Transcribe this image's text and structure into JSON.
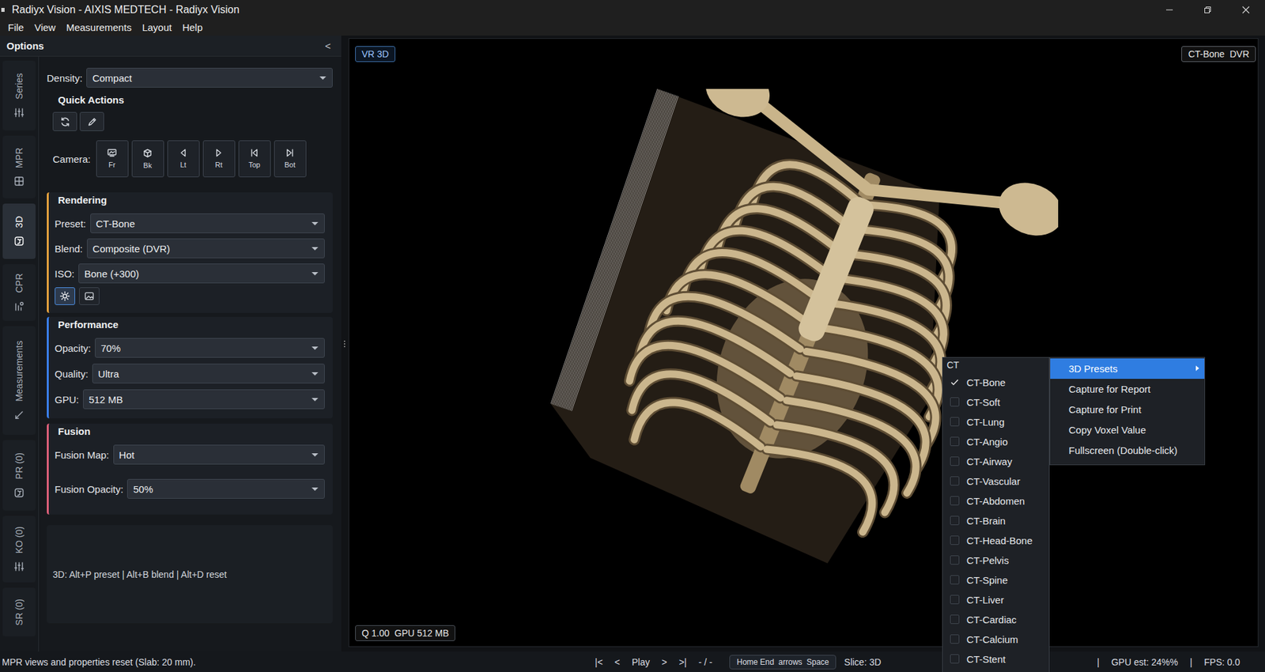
{
  "window": {
    "title": "Radiyx Vision - AIXIS MEDTECH - Radiyx Vision"
  },
  "menu_bar": [
    {
      "label": "File"
    },
    {
      "label": "View"
    },
    {
      "label": "Measurements"
    },
    {
      "label": "Layout"
    },
    {
      "label": "Help"
    }
  ],
  "options_panel": {
    "title": "Options",
    "collapse": "<"
  },
  "side_tabs": [
    {
      "label": "Series",
      "selected": false
    },
    {
      "label": "MPR",
      "selected": false
    },
    {
      "label": "3D",
      "selected": true
    },
    {
      "label": "CPR",
      "selected": false
    },
    {
      "label": "Measurements",
      "selected": false
    },
    {
      "label": "PR (0)",
      "selected": false
    },
    {
      "label": "KO (0)",
      "selected": false
    },
    {
      "label": "SR (0)",
      "selected": false
    }
  ],
  "density": {
    "label": "Density:",
    "value": "Compact"
  },
  "quick_actions": {
    "title": "Quick Actions"
  },
  "camera": {
    "label": "Camera:",
    "buttons": [
      "Fr",
      "Bk",
      "Lt",
      "Rt",
      "Top",
      "Bot"
    ]
  },
  "sections": [
    {
      "title": "Rendering",
      "color": "#e8a33d",
      "fields": [
        {
          "label": "Preset:",
          "value": "CT-Bone"
        },
        {
          "label": "Blend:",
          "value": "Composite (DVR)"
        },
        {
          "label": "ISO:",
          "value": "Bone (+300)"
        }
      ],
      "toggles": [
        {
          "selected": true
        },
        {
          "selected": false
        }
      ]
    },
    {
      "title": "Performance",
      "color": "#3b82f6",
      "fields": [
        {
          "label": "Opacity:",
          "value": "70%"
        },
        {
          "label": "Quality:",
          "value": "Ultra"
        },
        {
          "label": "GPU:",
          "value": "512 MB"
        }
      ],
      "toggles": []
    },
    {
      "title": "Fusion",
      "color": "#e0607a",
      "fields": [
        {
          "label": "Fusion Map:",
          "value": "Hot"
        },
        {
          "label": "Fusion Opacity:",
          "value": "50%"
        }
      ],
      "toggles": []
    }
  ],
  "hint": "3D: Alt+P preset | Alt+B blend | Alt+D reset",
  "viewport": {
    "mode": "VR 3D",
    "preset": "CT-Bone  DVR",
    "info": "Q 1.00  GPU 512 MB"
  },
  "context_menu": [
    {
      "label": "3D Presets",
      "selected": true,
      "submenu": true
    },
    {
      "label": "Capture for Report",
      "selected": false,
      "submenu": false
    },
    {
      "label": "Capture for Print",
      "selected": false,
      "submenu": false
    },
    {
      "label": "Copy Voxel Value",
      "selected": false,
      "submenu": false
    },
    {
      "label": "Fullscreen (Double-click)",
      "selected": false,
      "submenu": false
    }
  ],
  "presets_menu": {
    "header": "CT",
    "items": [
      {
        "label": "CT-Bone",
        "checked": true
      },
      {
        "label": "CT-Soft",
        "checked": false
      },
      {
        "label": "CT-Lung",
        "checked": false
      },
      {
        "label": "CT-Angio",
        "checked": false
      },
      {
        "label": "CT-Airway",
        "checked": false
      },
      {
        "label": "CT-Vascular",
        "checked": false
      },
      {
        "label": "CT-Abdomen",
        "checked": false
      },
      {
        "label": "CT-Brain",
        "checked": false
      },
      {
        "label": "CT-Head-Bone",
        "checked": false
      },
      {
        "label": "CT-Pelvis",
        "checked": false
      },
      {
        "label": "CT-Spine",
        "checked": false
      },
      {
        "label": "CT-Liver",
        "checked": false
      },
      {
        "label": "CT-Cardiac",
        "checked": false
      },
      {
        "label": "CT-Calcium",
        "checked": false
      },
      {
        "label": "CT-Stent",
        "checked": false
      }
    ]
  },
  "status_bar": {
    "message": "MPR views and properties reset (Slab: 20 mm).",
    "nav": [
      "|<",
      "<",
      "Play",
      ">",
      ">|",
      "- / -"
    ],
    "keys": "Home End  arrows  Space",
    "slice": "Slice: 3D",
    "separators": [
      "|",
      "|"
    ],
    "gpu": "GPU est: 24%%",
    "fps": "FPS: 0.0"
  }
}
